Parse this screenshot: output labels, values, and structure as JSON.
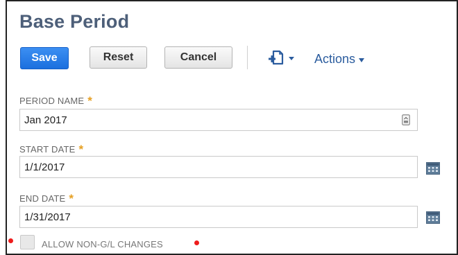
{
  "page": {
    "title": "Base Period"
  },
  "toolbar": {
    "save_label": "Save",
    "reset_label": "Reset",
    "cancel_label": "Cancel",
    "new_doc_icon": "new-document-icon",
    "actions_label": "Actions"
  },
  "form": {
    "period_name": {
      "label": "PERIOD NAME",
      "required_marker": "*",
      "value": "Jan 2017",
      "icon": "field-picker-icon"
    },
    "start_date": {
      "label": "START DATE",
      "required_marker": "*",
      "value": "1/1/2017",
      "icon": "calendar-icon"
    },
    "end_date": {
      "label": "END DATE",
      "required_marker": "*",
      "value": "1/31/2017",
      "icon": "calendar-icon"
    },
    "allow_non_gl": {
      "label": "ALLOW NON-G/L CHANGES",
      "checked": false
    }
  },
  "colors": {
    "title": "#4d5f79",
    "primary_button": "#1b6fde",
    "link": "#2b5c9e",
    "required": "#e6a023",
    "annotation_dot": "#ee1c1c"
  }
}
